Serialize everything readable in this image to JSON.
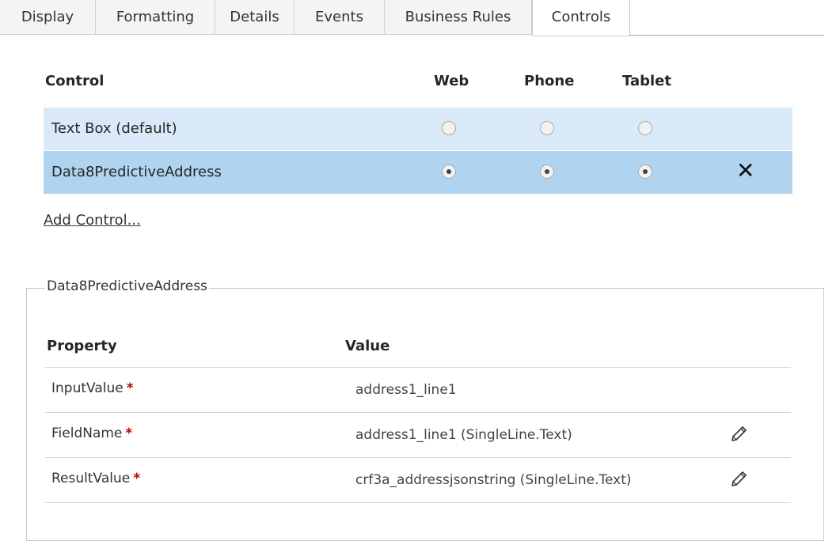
{
  "tabs": [
    {
      "label": "Display"
    },
    {
      "label": "Formatting"
    },
    {
      "label": "Details"
    },
    {
      "label": "Events"
    },
    {
      "label": "Business Rules"
    },
    {
      "label": "Controls"
    }
  ],
  "active_tab": "Controls",
  "controls": {
    "headers": {
      "control": "Control",
      "web": "Web",
      "phone": "Phone",
      "tablet": "Tablet"
    },
    "rows": [
      {
        "name": "Text Box (default)",
        "web": false,
        "phone": false,
        "tablet": false,
        "row_color": "#d9e9f7"
      },
      {
        "name": "Data8PredictiveAddress",
        "web": true,
        "phone": true,
        "tablet": true,
        "row_color": "#b0d4ef"
      }
    ],
    "delete_icon": "✕"
  },
  "add_control_label": "Add Control...",
  "properties": {
    "legend": "Data8PredictiveAddress",
    "headers": {
      "property": "Property",
      "value": "Value"
    },
    "required_marker": "*",
    "rows": [
      {
        "name": "InputValue",
        "value": "address1_line1",
        "editable": false
      },
      {
        "name": "FieldName",
        "value": "address1_line1 (SingleLine.Text)",
        "editable": true
      },
      {
        "name": "ResultValue",
        "value": "crf3a_addressjsonstring (SingleLine.Text)",
        "editable": true
      }
    ]
  }
}
